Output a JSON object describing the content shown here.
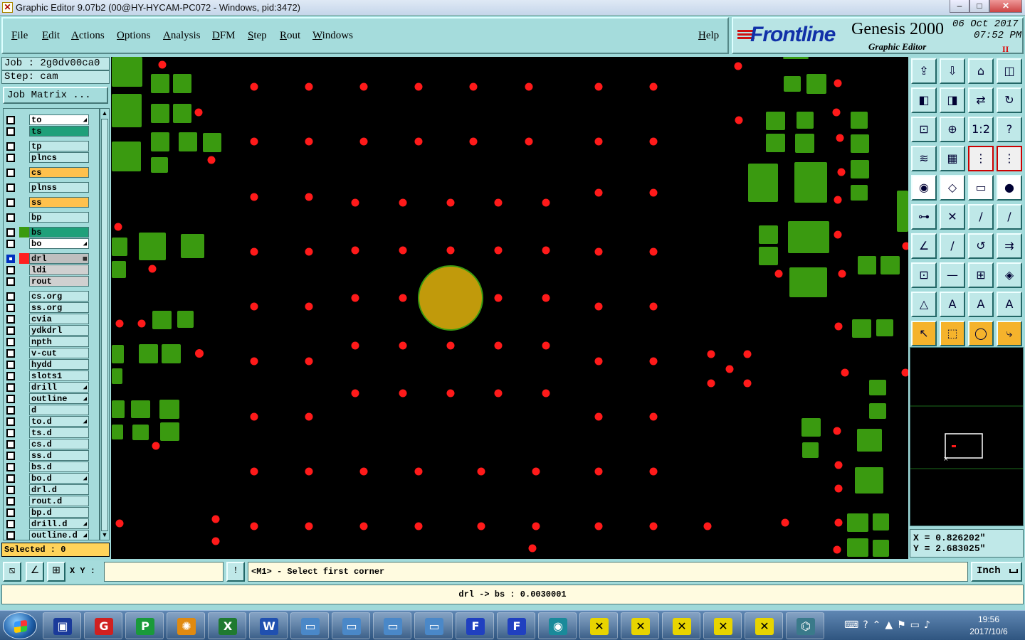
{
  "window": {
    "title": "Graphic Editor 9.07b2 (00@HY-HYCAM-PC072 - Windows, pid:3472)",
    "minimize": "–",
    "maximize": "□",
    "close": "✕"
  },
  "menu": {
    "items": [
      "File",
      "Edit",
      "Actions",
      "Options",
      "Analysis",
      "DFM",
      "Step",
      "Rout",
      "Windows"
    ],
    "help": "Help"
  },
  "brand": {
    "logo": "Frontline",
    "product": "Genesis 2000",
    "subtitle": "Graphic Editor",
    "date": "06 Oct 2017",
    "time": "07:52 PM",
    "pause": "II"
  },
  "job": {
    "job_line": "Job : 2g0dv00ca0",
    "step_line": "Step: cam",
    "matrix_button": "Job Matrix ..."
  },
  "layers": [
    {
      "name": "to",
      "color": "#ffffff",
      "group": 0,
      "flag": "◢"
    },
    {
      "name": "ts",
      "color": "#1fa07a",
      "group": 0
    },
    {
      "name": "tp",
      "color": "#bfe8e8",
      "group": 1
    },
    {
      "name": "plncs",
      "color": "#bfe8e8",
      "group": 1
    },
    {
      "name": "cs",
      "color": "#ffc14d",
      "group": 2
    },
    {
      "name": "plnss",
      "color": "#bfe8e8",
      "group": 3
    },
    {
      "name": "ss",
      "color": "#ffc14d",
      "group": 4
    },
    {
      "name": "bp",
      "color": "#bfe8e8",
      "group": 5
    },
    {
      "name": "bs",
      "color": "#1fa07a",
      "group": 6,
      "swatch": "#3a9a10"
    },
    {
      "name": "bo",
      "color": "#ffffff",
      "group": 6,
      "flag": "◢"
    },
    {
      "name": "drl",
      "color": "#bfbfbf",
      "group": 7,
      "swatch": "#ff2020",
      "active": true,
      "flag": "▦"
    },
    {
      "name": "ldi",
      "color": "#d0d0d0",
      "group": 7
    },
    {
      "name": "rout",
      "color": "#d0d0d0",
      "group": 7
    },
    {
      "name": "cs.org",
      "color": "#bfe8e8",
      "group": 8
    },
    {
      "name": "ss.org",
      "color": "#bfe8e8",
      "group": 8
    },
    {
      "name": "cvia",
      "color": "#bfe8e8",
      "group": 8
    },
    {
      "name": "ydkdrl",
      "color": "#bfe8e8",
      "group": 8
    },
    {
      "name": "npth",
      "color": "#bfe8e8",
      "group": 8
    },
    {
      "name": "v-cut",
      "color": "#bfe8e8",
      "group": 8
    },
    {
      "name": "hydd",
      "color": "#bfe8e8",
      "group": 8
    },
    {
      "name": "slots1",
      "color": "#bfe8e8",
      "group": 8
    },
    {
      "name": "drill",
      "color": "#bfe8e8",
      "group": 8,
      "flag": "◢"
    },
    {
      "name": "outline",
      "color": "#bfe8e8",
      "group": 8,
      "flag": "◢"
    },
    {
      "name": "d",
      "color": "#bfe8e8",
      "group": 8
    },
    {
      "name": "to.d",
      "color": "#bfe8e8",
      "group": 8,
      "flag": "◢"
    },
    {
      "name": "ts.d",
      "color": "#bfe8e8",
      "group": 8
    },
    {
      "name": "cs.d",
      "color": "#bfe8e8",
      "group": 8
    },
    {
      "name": "ss.d",
      "color": "#bfe8e8",
      "group": 8
    },
    {
      "name": "bs.d",
      "color": "#bfe8e8",
      "group": 8
    },
    {
      "name": "bo.d",
      "color": "#bfe8e8",
      "group": 8,
      "flag": "◢"
    },
    {
      "name": "drl.d",
      "color": "#bfe8e8",
      "group": 8
    },
    {
      "name": "rout.d",
      "color": "#bfe8e8",
      "group": 8
    },
    {
      "name": "bp.d",
      "color": "#bfe8e8",
      "group": 8
    },
    {
      "name": "drill.d",
      "color": "#bfe8e8",
      "group": 8,
      "flag": "◢"
    },
    {
      "name": "outline.d",
      "color": "#bfe8e8",
      "group": 8,
      "flag": "◢"
    }
  ],
  "selected": "Selected : 0",
  "coords": {
    "x": "X = 0.826202\"",
    "y": "Y = 2.683025\""
  },
  "command": {
    "xy_label": "X Y :",
    "xy_value": "",
    "prompt": "<M1> - Select first corner",
    "units": "Inch",
    "exclaim": "!"
  },
  "status": "drl -> bs : 0.0030001",
  "colors": {
    "pad": "#3a9a10",
    "drill": "#ff1a1a",
    "big_hole": "#c19a0b",
    "background": "#000000",
    "panel": "#a5dcdc"
  },
  "tray": {
    "time": "19:56",
    "date": "2017/10/6"
  },
  "taskbar_icons": [
    "save-icon",
    "g-app-icon",
    "p-app-icon",
    "shell-icon",
    "excel-icon",
    "word-icon",
    "window-icon",
    "window-icon",
    "window-icon",
    "window-icon",
    "frontline-icon",
    "frontline-icon",
    "eye-icon",
    "graphic-editor-icon",
    "graphic-editor-icon",
    "graphic-editor-icon",
    "graphic-editor-icon",
    "graphic-editor-icon",
    "network-app-icon"
  ]
}
